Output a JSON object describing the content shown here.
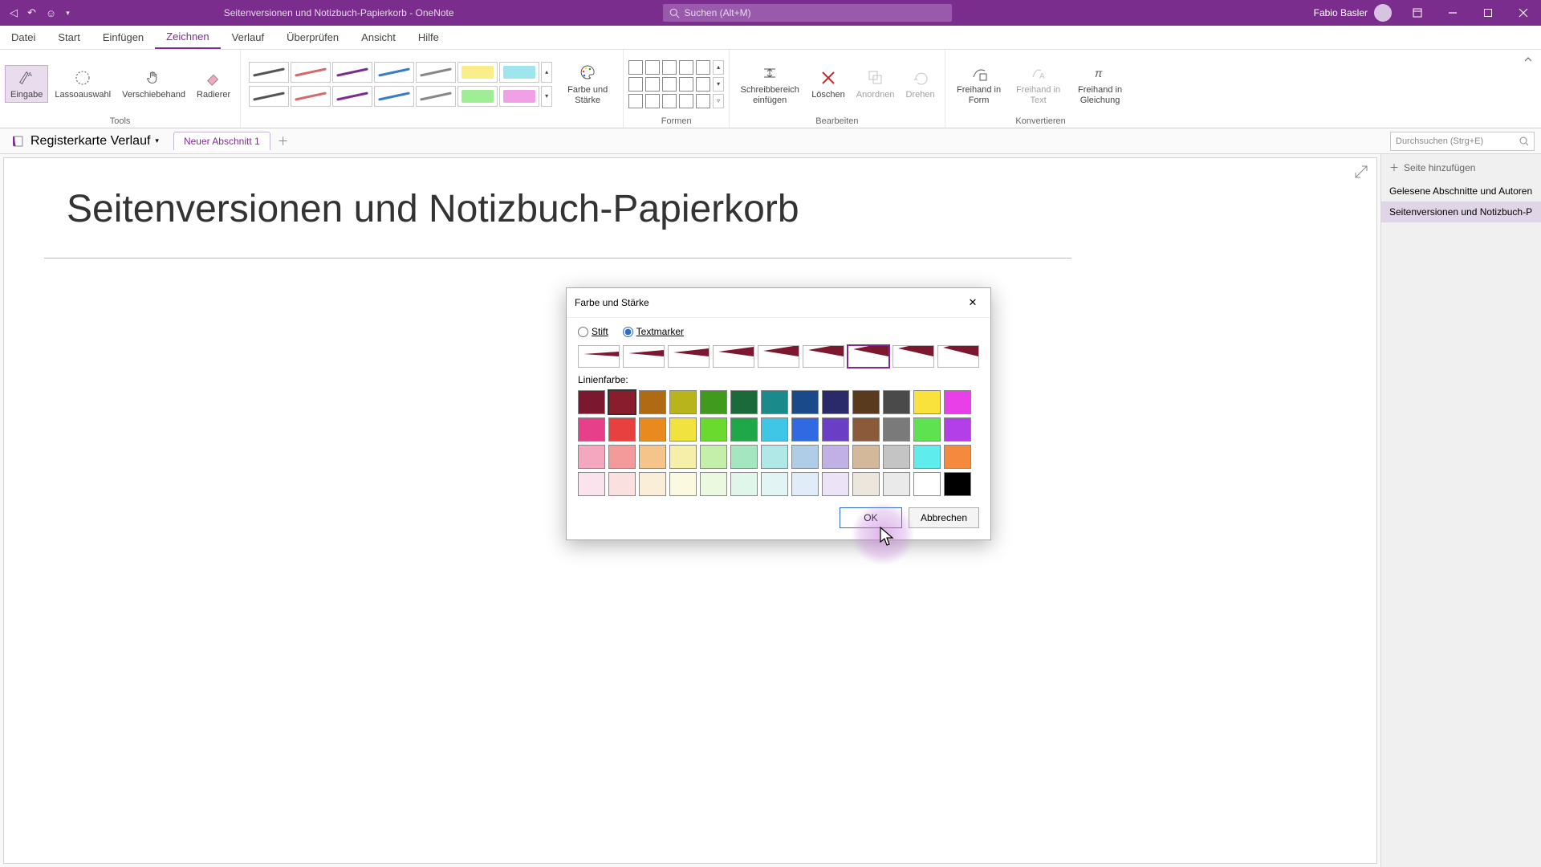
{
  "titlebar": {
    "title": "Seitenversionen und Notizbuch-Papierkorb  -  OneNote",
    "search_placeholder": "Suchen (Alt+M)",
    "username": "Fabio Basler"
  },
  "ribbon_tabs": [
    "Datei",
    "Start",
    "Einfügen",
    "Zeichnen",
    "Verlauf",
    "Überprüfen",
    "Ansicht",
    "Hilfe"
  ],
  "ribbon_active_tab": 3,
  "ribbon": {
    "group_tools": {
      "label": "Tools",
      "eingabe": "Eingabe",
      "lasso": "Lassoauswahl",
      "verschiebe": "Verschiebehand",
      "radierer": "Radierer"
    },
    "pens": {
      "strokes_row1": [
        "#555555",
        "#d46a6a",
        "#7b2d8e",
        "#3b7bc9",
        "#888888"
      ],
      "highlighters_row1": [
        "#f9e23c",
        "#5fd3e3"
      ],
      "strokes_row2": [
        "#555555",
        "#d46a6a",
        "#7b2d8e",
        "#3b7bc9",
        "#888888"
      ],
      "highlighters_row2": [
        "#5fe24f",
        "#e85fd6"
      ]
    },
    "farbe_staerke": "Farbe und Stärke",
    "group_formen": {
      "label": "Formen"
    },
    "group_bearbeiten": {
      "label": "Bearbeiten",
      "schreib": "Schreibbereich einfügen",
      "loeschen": "Löschen",
      "anordnen": "Anordnen",
      "drehen": "Drehen"
    },
    "group_konvertieren": {
      "label": "Konvertieren",
      "form": "Freihand in Form",
      "text": "Freihand in Text",
      "gleichung": "Freihand in Gleichung"
    }
  },
  "nb": {
    "name": "Registerkarte Verlauf",
    "section": "Neuer Abschnitt 1",
    "search_placeholder": "Durchsuchen (Strg+E)"
  },
  "pagepane": {
    "add": "Seite hinzufügen",
    "items": [
      "Gelesene Abschnitte und Autoren",
      "Seitenversionen und Notizbuch-P"
    ]
  },
  "page": {
    "title": "Seitenversionen und Notizbuch-Papierkorb"
  },
  "dialog": {
    "title": "Farbe und Stärke",
    "radio_stift": "Stift",
    "radio_marker": "Textmarker",
    "radio_selected": "marker",
    "thickness_selected": 6,
    "thickness_count": 9,
    "thickness_color": "#7b1830",
    "linienfarbe": "Linienfarbe:",
    "colors": [
      [
        "#7b1830",
        "#8a1d2b",
        "#b06a14",
        "#b7b51b",
        "#3f9a1e",
        "#1a6a3a",
        "#1b8a8a",
        "#1a4a8a",
        "#2a2a6a",
        "#5a3a1e",
        "#4a4a4a",
        "#f9e23c",
        "#e83fe8"
      ],
      [
        "#e83f8b",
        "#e83f3f",
        "#e88a1e",
        "#f2e23f",
        "#6ada2f",
        "#1fa847",
        "#3fc6e6",
        "#2f6ae2",
        "#6a3fc6",
        "#8a5a3a",
        "#7a7a7a",
        "#5fe24f",
        "#b23fe8"
      ],
      [
        "#f5a7c0",
        "#f59a9a",
        "#f5c48a",
        "#f5efaa",
        "#c4efaa",
        "#a4e6c0",
        "#b0e8e8",
        "#b0cde8",
        "#c0b0e6",
        "#d4b89a",
        "#c4c4c4",
        "#5fecec",
        "#f58a3f"
      ],
      [
        "#fbe3ee",
        "#fbe0e0",
        "#fbeed8",
        "#fbf9e0",
        "#eaf9df",
        "#e0f6ea",
        "#e2f4f4",
        "#e0edf8",
        "#ece4f6",
        "#ece6dc",
        "#eaeaea",
        "#ffffff",
        "#000000"
      ]
    ],
    "selected_color": [
      0,
      1
    ],
    "ok": "OK",
    "cancel": "Abbrechen"
  }
}
